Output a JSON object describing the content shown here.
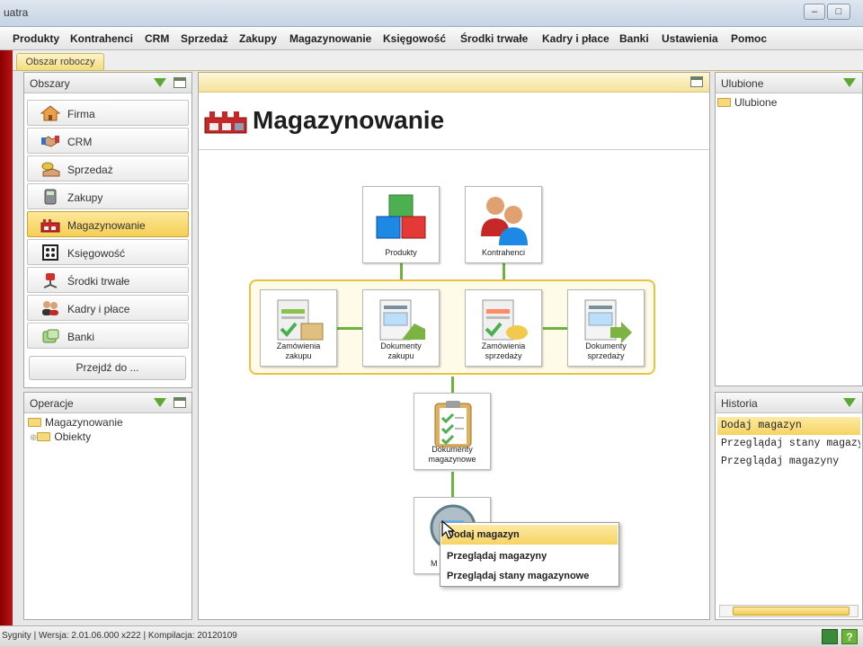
{
  "window": {
    "title": "uatra",
    "btn_min": "–",
    "btn_max": "□"
  },
  "menu": [
    "Produkty",
    "Kontrahenci",
    "CRM",
    "Sprzedaż",
    "Zakupy",
    "Magazynowanie",
    "Księgowość",
    "Środki trwałe",
    "Kadry i płace",
    "Banki",
    "Ustawienia",
    "Pomoc"
  ],
  "workspace_tab": "Obszar roboczy",
  "areas": {
    "title": "Obszary",
    "items": [
      {
        "label": "Firma"
      },
      {
        "label": "CRM"
      },
      {
        "label": "Sprzedaż"
      },
      {
        "label": "Zakupy"
      },
      {
        "label": "Magazynowanie",
        "selected": true
      },
      {
        "label": "Księgowość"
      },
      {
        "label": "Środki trwałe"
      },
      {
        "label": "Kadry i płace"
      },
      {
        "label": "Banki"
      }
    ],
    "goto": "Przejdź do ..."
  },
  "operations": {
    "title": "Operacje",
    "root": "Magazynowanie",
    "child": "Obiekty"
  },
  "center": {
    "title": "Magazynowanie",
    "nodes": {
      "produkty": "Produkty",
      "kontrahenci": "Kontrahenci",
      "zam_zakupu_1": "Zamówienia",
      "zam_zakupu_2": "zakupu",
      "dok_zakupu_1": "Dokumenty",
      "dok_zakupu_2": "zakupu",
      "zam_sprzedazy_1": "Zamówienia",
      "zam_sprzedazy_2": "sprzedaży",
      "dok_sprzedazy_1": "Dokumenty",
      "dok_sprzedazy_2": "sprzedaży",
      "dok_mag_1": "Dokumenty",
      "dok_mag_2": "magazynowe",
      "magazyny_partial": "M"
    },
    "context_menu": [
      "Dodaj magazyn",
      "Przeglądaj magazyny",
      "Przeglądaj stany magazynowe"
    ]
  },
  "favorites": {
    "title": "Ulubione",
    "folder": "Ulubione"
  },
  "history": {
    "title": "Historia",
    "items": [
      "Dodaj magazyn",
      "Przeglądaj stany magazynowe",
      "Przeglądaj magazyny"
    ]
  },
  "status": "Sygnity | Wersja: 2.01.06.000 x222 | Kompilacja: 20120109",
  "colors": {
    "accent_yellow": "#f6d364",
    "connector_green": "#6bb33b",
    "brand_red": "#b71515"
  }
}
